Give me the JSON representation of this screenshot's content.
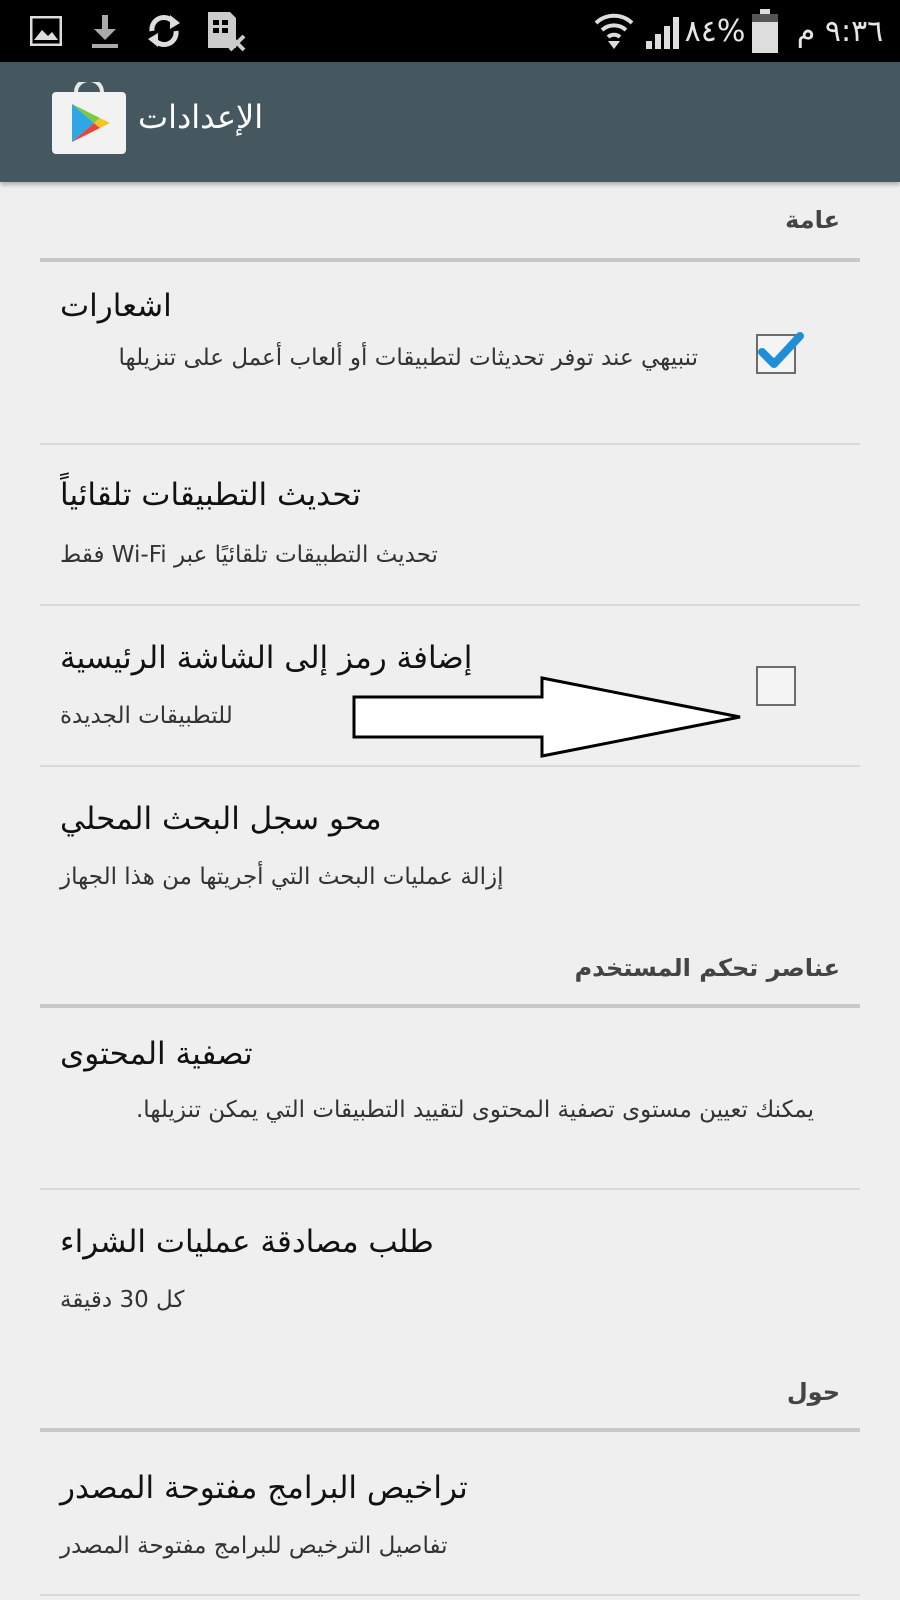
{
  "status_bar": {
    "time": "٩:٣٦ م",
    "battery": "٨٤%"
  },
  "action_bar": {
    "title": "الإعدادات"
  },
  "sections": {
    "general": "عامة",
    "user_controls": "عناصر تحكم المستخدم",
    "about": "حول"
  },
  "settings": {
    "notifications": {
      "title": "اشعارات",
      "subtitle": "تنبيهي عند توفر تحديثات لتطبيقات أو ألعاب أعمل على تنزيلها",
      "checked": true
    },
    "auto_update": {
      "title": "تحديث التطبيقات تلقائياً",
      "subtitle": "تحديث التطبيقات تلقائيًا عبر Wi-Fi فقط"
    },
    "add_icon": {
      "title": "إضافة رمز إلى الشاشة الرئيسية",
      "subtitle": "للتطبيقات الجديدة",
      "checked": false
    },
    "clear_history": {
      "title": "محو سجل البحث المحلي",
      "subtitle": "إزالة عمليات البحث التي أجريتها من هذا الجهاز"
    },
    "content_filter": {
      "title": "تصفية المحتوى",
      "subtitle": "يمكنك تعيين مستوى تصفية المحتوى لتقييد التطبيقات التي يمكن تنزيلها."
    },
    "purchase_auth": {
      "title": "طلب مصادقة عمليات الشراء",
      "subtitle": "كل 30 دقيقة"
    },
    "licenses": {
      "title": "تراخيص البرامج مفتوحة المصدر",
      "subtitle": "تفاصيل الترخيص للبرامج مفتوحة المصدر"
    }
  },
  "colors": {
    "action_bar": "#46585f",
    "background": "#efefef",
    "check_accent": "#1e8fd6"
  }
}
